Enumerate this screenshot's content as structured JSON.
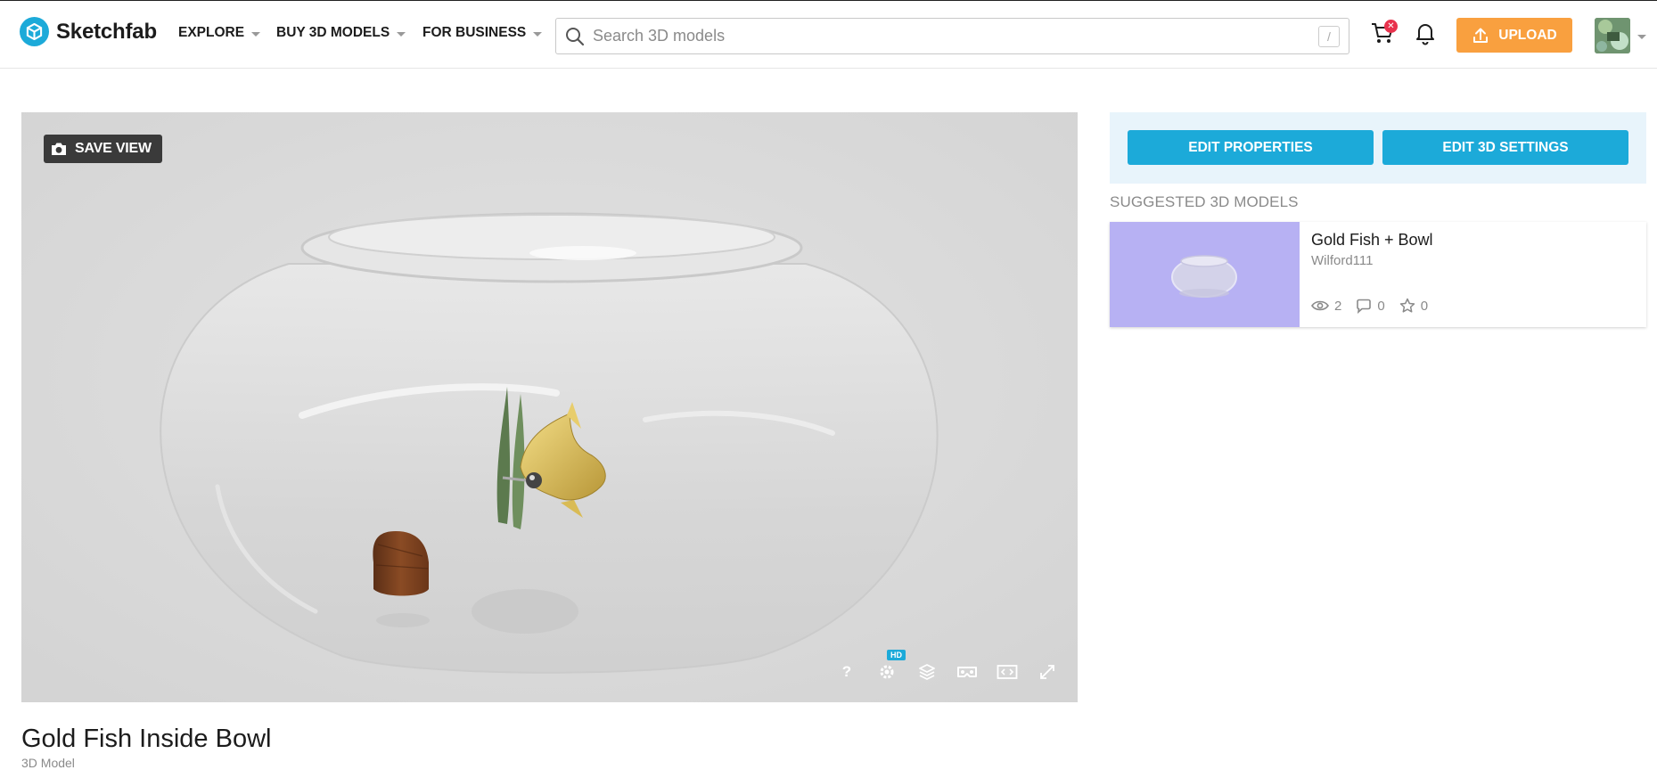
{
  "app": {
    "name": "Sketchfab"
  },
  "nav": {
    "explore": "EXPLORE",
    "buy": "BUY 3D MODELS",
    "business": "FOR BUSINESS"
  },
  "search": {
    "placeholder": "Search 3D models",
    "shortcut": "/"
  },
  "header": {
    "upload_label": "UPLOAD",
    "cart_icon": "cart-icon",
    "bell_icon": "bell-icon"
  },
  "viewer": {
    "save_view_label": "SAVE VIEW",
    "toolbar": {
      "help": "?",
      "hd_badge": "HD",
      "icons": [
        "help-icon",
        "settings-icon",
        "layers-icon",
        "vr-icon",
        "embed-icon",
        "fullscreen-icon"
      ]
    }
  },
  "owner_panel": {
    "edit_properties": "EDIT PROPERTIES",
    "edit_3d_settings": "EDIT 3D SETTINGS"
  },
  "suggested": {
    "heading": "SUGGESTED 3D MODELS",
    "items": [
      {
        "title": "Gold Fish + Bowl",
        "author": "Wilford111",
        "views": "2",
        "comments": "0",
        "likes": "0"
      }
    ]
  },
  "model": {
    "title": "Gold Fish Inside Bowl",
    "subtitle": "3D Model"
  },
  "colors": {
    "brand": "#1caad9",
    "upload": "#f9a03f",
    "badge": "#e8324d",
    "thumb_bg": "#b7b1f3"
  }
}
